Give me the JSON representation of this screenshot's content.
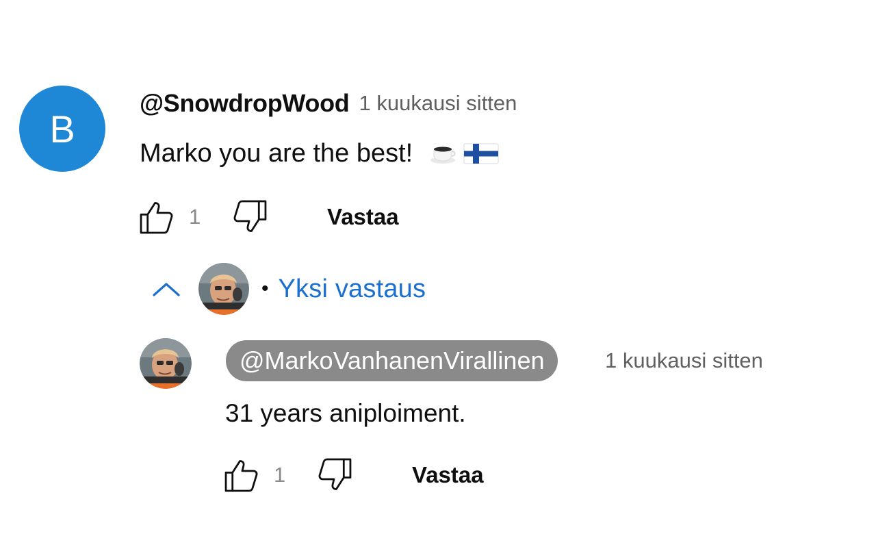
{
  "comment": {
    "avatar_letter": "B",
    "avatar_color": "#1e88d6",
    "author": "@SnowdropWood",
    "time": "1 kuukausi sitten",
    "text": "Marko you are the best!",
    "emojis": [
      "coffee-cup-emoji",
      "finnish-flag-emoji"
    ],
    "like_count": "1",
    "reply_label": "Vastaa"
  },
  "replies_toggle": {
    "separator": "•",
    "label": "Yksi vastaus",
    "link_color": "#1a6fcf"
  },
  "reply": {
    "author": "@MarkoVanhanenVirallinen",
    "author_badge_color": "#8a8a8a",
    "time": "1 kuukausi sitten",
    "text": "31 years aniploiment.",
    "like_count": "1",
    "reply_label": "Vastaa"
  }
}
